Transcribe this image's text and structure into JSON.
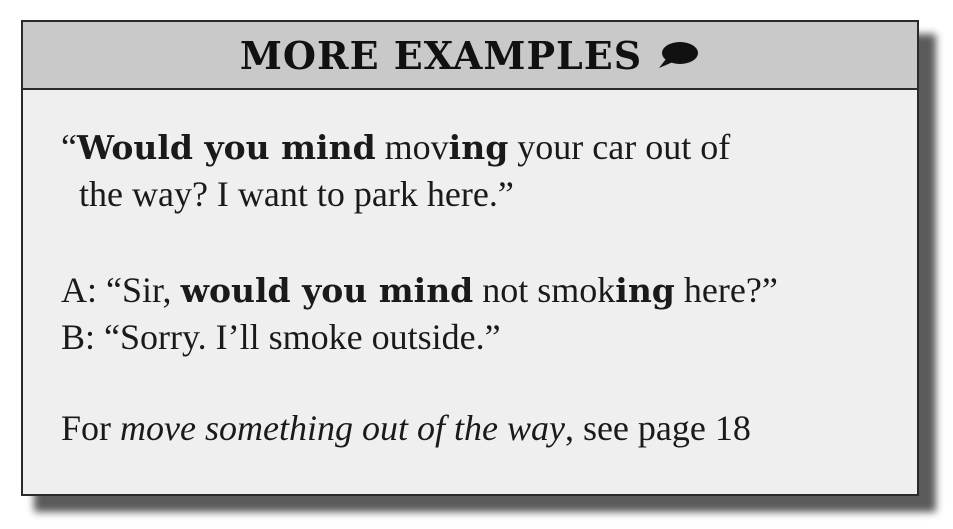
{
  "header": {
    "title": "MORE EXAMPLES",
    "icon": "speech-bubble-icon"
  },
  "example1": {
    "open_quote": "“",
    "bold1": "Would you mind",
    "t1": " mov",
    "bold2": "ing",
    "t2": " your car out of",
    "line2": "the way? I want to park here.”"
  },
  "example2": {
    "a_prefix": "A: “Sir, ",
    "a_bold1": "would you mind",
    "a_t1": " not smok",
    "a_bold2": "ing",
    "a_t2": " here?”",
    "b_line": "B: “Sorry. I’ll smoke outside.”"
  },
  "reference": {
    "pre": "For ",
    "italic": "move something out of the way",
    "post": ", see page 18"
  }
}
